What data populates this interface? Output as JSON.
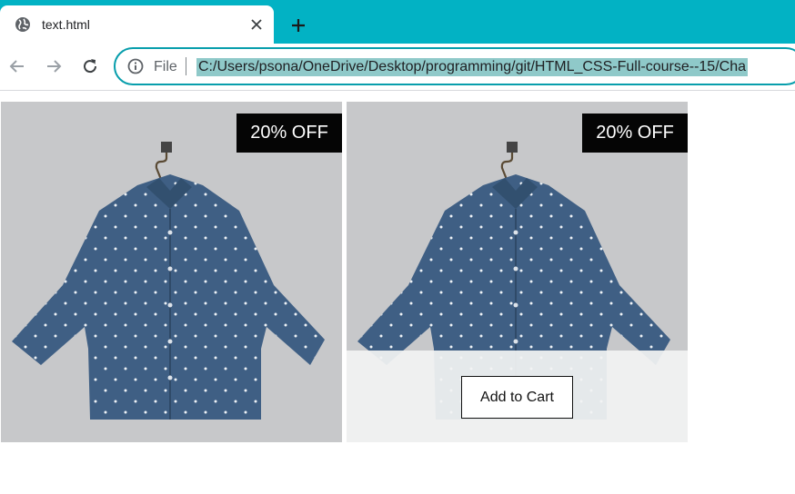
{
  "browser": {
    "tab": {
      "title": "text.html",
      "favicon": "globe-icon",
      "close_icon": "close-icon"
    },
    "new_tab_icon": "plus-icon",
    "nav": {
      "back_icon": "arrow-left-icon",
      "forward_icon": "arrow-right-icon",
      "reload_icon": "reload-icon"
    },
    "omnibox": {
      "info_icon": "info-icon",
      "scheme_label": "File",
      "url": "C:/Users/psona/OneDrive/Desktop/programming/git/HTML_CSS-Full-course--15/Cha"
    },
    "colors": {
      "tabstrip": "#02b2c4",
      "omnibox_border": "#089eac",
      "url_selection": "#8fc9c9"
    }
  },
  "products": [
    {
      "badge": "20% OFF",
      "image": "denim-shirt-on-hanger"
    },
    {
      "badge": "20% OFF",
      "image": "denim-shirt-on-hanger",
      "cart_button": "Add to Cart"
    }
  ]
}
